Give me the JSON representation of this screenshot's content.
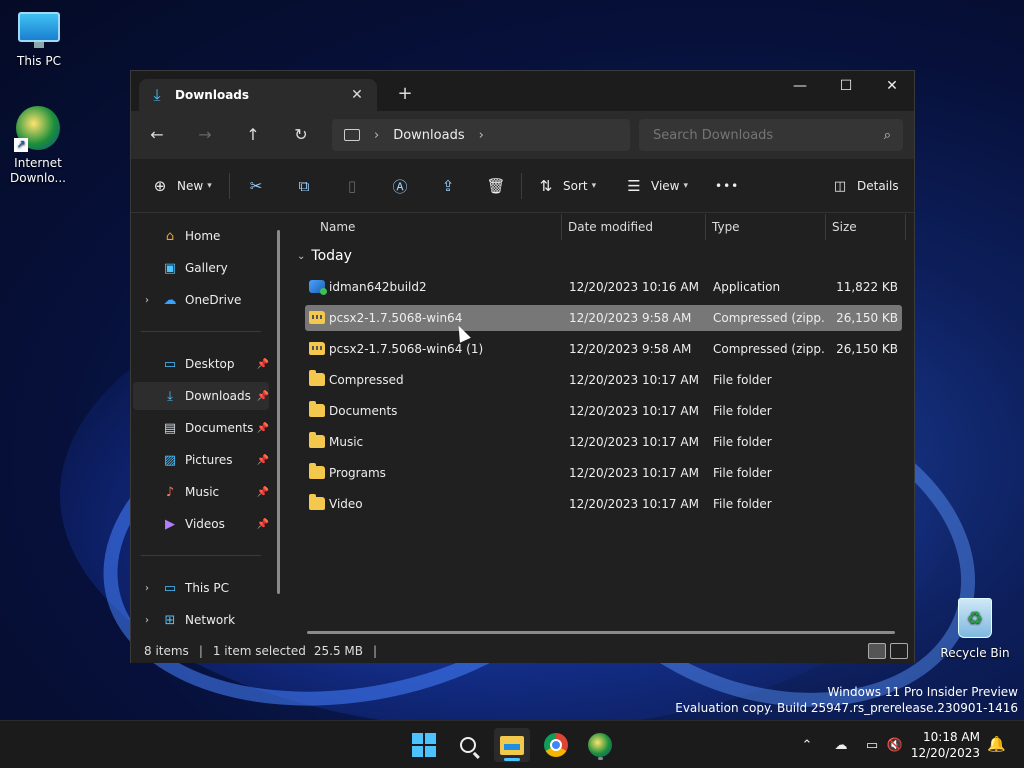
{
  "desktop": {
    "icons": [
      {
        "label": "This PC"
      },
      {
        "label": "Internet\nDownlo..."
      },
      {
        "label": "Recycle Bin"
      }
    ],
    "watermark_line1": "Windows 11 Pro Insider Preview",
    "watermark_line2": "Evaluation copy. Build 25947.rs_prerelease.230901-1416"
  },
  "window": {
    "tab_title": "Downloads",
    "controls": {
      "minimize": "—",
      "maximize": "☐",
      "close": "✕"
    },
    "new_tab": "+",
    "nav": {
      "back": "←",
      "forward": "→",
      "up": "↑",
      "refresh": "↻"
    },
    "address": {
      "crumbs": [
        "Downloads"
      ]
    },
    "search": {
      "placeholder": "Search Downloads"
    },
    "toolbar": {
      "new_label": "New",
      "sort_label": "Sort",
      "view_label": "View",
      "more_label": "•••",
      "details_label": "Details"
    },
    "sidebar": {
      "items": [
        {
          "label": "Home"
        },
        {
          "label": "Gallery"
        },
        {
          "label": "OneDrive"
        },
        {
          "label": "Desktop"
        },
        {
          "label": "Downloads"
        },
        {
          "label": "Documents"
        },
        {
          "label": "Pictures"
        },
        {
          "label": "Music"
        },
        {
          "label": "Videos"
        },
        {
          "label": "This PC"
        },
        {
          "label": "Network"
        }
      ]
    },
    "columns": {
      "name": "Name",
      "date": "Date modified",
      "type": "Type",
      "size": "Size"
    },
    "group": "Today",
    "files": [
      {
        "name": "idman642build2",
        "date": "12/20/2023 10:16 AM",
        "type": "Application",
        "size": "11,822 KB"
      },
      {
        "name": "pcsx2-1.7.5068-win64",
        "date": "12/20/2023 9:58 AM",
        "type": "Compressed (zipp...",
        "size": "26,150 KB"
      },
      {
        "name": "pcsx2-1.7.5068-win64 (1)",
        "date": "12/20/2023 9:58 AM",
        "type": "Compressed (zipp...",
        "size": "26,150 KB"
      },
      {
        "name": "Compressed",
        "date": "12/20/2023 10:17 AM",
        "type": "File folder",
        "size": ""
      },
      {
        "name": "Documents",
        "date": "12/20/2023 10:17 AM",
        "type": "File folder",
        "size": ""
      },
      {
        "name": "Music",
        "date": "12/20/2023 10:17 AM",
        "type": "File folder",
        "size": ""
      },
      {
        "name": "Programs",
        "date": "12/20/2023 10:17 AM",
        "type": "File folder",
        "size": ""
      },
      {
        "name": "Video",
        "date": "12/20/2023 10:17 AM",
        "type": "File folder",
        "size": ""
      }
    ],
    "status": {
      "count": "8 items",
      "selection": "1 item selected",
      "size": "25.5 MB"
    }
  },
  "taskbar": {
    "time": "10:18 AM",
    "date": "12/20/2023"
  },
  "colors": {
    "accent": "#4cc2ff",
    "folder": "#f4c84d",
    "selected_row": "#777777"
  }
}
